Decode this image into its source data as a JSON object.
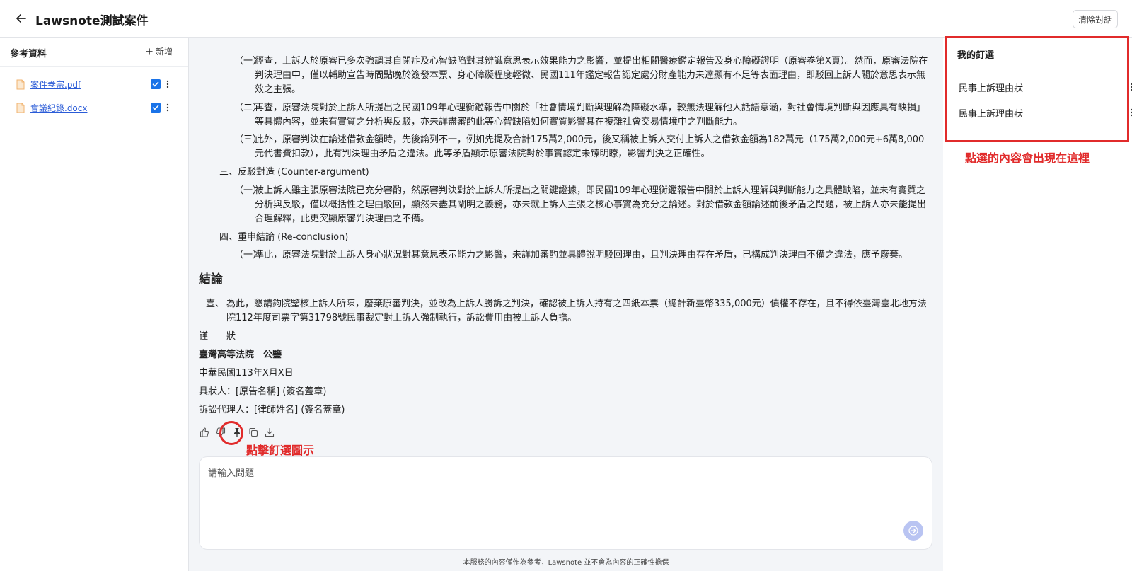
{
  "header": {
    "title": "Lawsnote測試案件",
    "clear_label": "清除對話"
  },
  "left_sidebar": {
    "title": "參考資料",
    "add_label": "新增",
    "files": [
      {
        "name": "案件卷宗.pdf",
        "checked": true
      },
      {
        "name": "會議紀錄.docx",
        "checked": true
      }
    ]
  },
  "document": {
    "items": [
      {
        "label": "（一）",
        "text": "經查，上訴人於原審已多次強調其自閉症及心智缺陷對其辨識意思表示效果能力之影響，並提出相關醫療鑑定報告及身心障礙證明（原審卷第X頁）。然而，原審法院在判決理由中，僅以輔助宣告時間點晚於簽發本票、身心障礙程度輕微、民國111年鑑定報告認定處分財產能力未達顯有不足等表面理由，即駁回上訴人關於意思表示無效之主張。"
      },
      {
        "label": "（二）",
        "text": "再查，原審法院對於上訴人所提出之民國109年心理衡鑑報告中關於「社會情境判斷與理解為障礙水準，較無法理解他人話語意涵，對社會情境判斷與因應具有缺損」等具體內容，並未有實質之分析與反駁，亦未詳盡審酌此等心智缺陷如何實質影響其在複雜社會交易情境中之判斷能力。"
      },
      {
        "label": "（三）",
        "text": "此外，原審判決在論述借款金額時，先後論列不一，例如先提及合計175萬2,000元，後又稱被上訴人交付上訴人之借款金額為182萬元（175萬2,000元+6萬8,000元代書費扣款），此有判決理由矛盾之違法。此等矛盾顯示原審法院對於事實認定未臻明瞭，影響判決之正確性。"
      }
    ],
    "section3": {
      "heading": "三、反駁對造 (Counter-argument)",
      "items": [
        {
          "label": "（一）",
          "text": "被上訴人雖主張原審法院已充分審酌，然原審判決對於上訴人所提出之關鍵證據，即民國109年心理衡鑑報告中關於上訴人理解與判斷能力之具體缺陷，並未有實質之分析與反駁，僅以概括性之理由駁回，顯然未盡其闡明之義務，亦未就上訴人主張之核心事實為充分之論述。對於借款金額論述前後矛盾之問題，被上訴人亦未能提出合理解釋，此更突顯原審判決理由之不備。"
        }
      ]
    },
    "section4": {
      "heading": "四、重申結論 (Re-conclusion)",
      "items": [
        {
          "label": "（一）",
          "text": "準此，原審法院對於上訴人身心狀況對其意思表示能力之影響，未詳加審酌並具體說明駁回理由，且判決理由存在矛盾，已構成判決理由不備之違法，應予廢棄。"
        }
      ]
    },
    "conclusion_title": "結論",
    "conclusion": {
      "label": "壹、",
      "text": "為此，懇請鈞院鑒核上訴人所陳，廢棄原審判決，並改為上訴人勝訴之判決，確認被上訴人持有之四紙本票（總計新臺幣335,000元）債權不存在，且不得依臺灣臺北地方法院112年度司票字第31798號民事裁定對上訴人強制執行，訴訟費用由被上訴人負擔。"
    },
    "closing": "謹　　狀",
    "court": "臺灣高等法院　公鑒",
    "date": "中華民國113年X月X日",
    "petitioner": "具狀人：[原告名稱] (簽名蓋章)",
    "agent": "訴訟代理人：[律師姓名] (簽名蓋章)"
  },
  "annotations": {
    "pin_hint": "點擊釘選圖示",
    "pins_hint": "點選的內容會出現在這裡"
  },
  "chat": {
    "placeholder": "請輸入問題",
    "disclaimer": "本服務的內容僅作為參考，Lawsnote 並不會為內容的正確性擔保"
  },
  "right_sidebar": {
    "title": "我的釘選",
    "pins": [
      "民事上訴理由狀",
      "民事上訴理由狀"
    ]
  },
  "colors": {
    "accent_blue": "#1a73e8",
    "annotation_red": "#e12b2b",
    "send_button": "#b9c4f2"
  }
}
